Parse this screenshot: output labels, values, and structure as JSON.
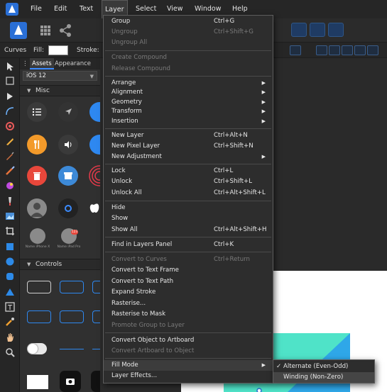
{
  "menubar": {
    "items": [
      "File",
      "Edit",
      "Text",
      "Layer",
      "Select",
      "View",
      "Window",
      "Help"
    ]
  },
  "contextbar": {
    "curves_label": "Curves",
    "fill_label": "Fill:",
    "stroke_label": "Stroke:"
  },
  "assets": {
    "tabs": [
      "Assets",
      "Appearance"
    ],
    "category": "iOS 12",
    "sections": [
      "Misc",
      "Controls"
    ],
    "asset_labels": [
      "Name iPhone X",
      "Name iPad Pro"
    ],
    "badge": "123"
  },
  "layer_menu": {
    "items": [
      {
        "label": "Group",
        "shortcut": "Ctrl+G",
        "disabled": false
      },
      {
        "label": "Ungroup",
        "shortcut": "Ctrl+Shift+G",
        "disabled": true
      },
      {
        "label": "Ungroup All",
        "shortcut": "",
        "disabled": true
      },
      {
        "label": "Create Compound",
        "shortcut": "",
        "disabled": true
      },
      {
        "label": "Release Compound",
        "shortcut": "",
        "disabled": true
      },
      {
        "label": "Arrange",
        "shortcut": "",
        "disabled": false,
        "submenu": true
      },
      {
        "label": "Alignment",
        "shortcut": "",
        "disabled": false,
        "submenu": true
      },
      {
        "label": "Geometry",
        "shortcut": "",
        "disabled": false,
        "submenu": true
      },
      {
        "label": "Transform",
        "shortcut": "",
        "disabled": false,
        "submenu": true
      },
      {
        "label": "Insertion",
        "shortcut": "",
        "disabled": false,
        "submenu": true
      },
      {
        "label": "New Layer",
        "shortcut": "Ctrl+Alt+N",
        "disabled": false
      },
      {
        "label": "New Pixel Layer",
        "shortcut": "Ctrl+Shift+N",
        "disabled": false
      },
      {
        "label": "New Adjustment",
        "shortcut": "",
        "disabled": false,
        "submenu": true
      },
      {
        "label": "Lock",
        "shortcut": "Ctrl+L",
        "disabled": false
      },
      {
        "label": "Unlock",
        "shortcut": "Ctrl+Shift+L",
        "disabled": false
      },
      {
        "label": "Unlock All",
        "shortcut": "Ctrl+Alt+Shift+L",
        "disabled": false
      },
      {
        "label": "Hide",
        "shortcut": "",
        "disabled": false
      },
      {
        "label": "Show",
        "shortcut": "",
        "disabled": false
      },
      {
        "label": "Show All",
        "shortcut": "Ctrl+Alt+Shift+H",
        "disabled": false
      },
      {
        "label": "Find in Layers Panel",
        "shortcut": "Ctrl+K",
        "disabled": false
      },
      {
        "label": "Convert to Curves",
        "shortcut": "Ctrl+Return",
        "disabled": true
      },
      {
        "label": "Convert to Text Frame",
        "shortcut": "",
        "disabled": false
      },
      {
        "label": "Convert to Text Path",
        "shortcut": "",
        "disabled": false
      },
      {
        "label": "Expand Stroke",
        "shortcut": "",
        "disabled": false
      },
      {
        "label": "Rasterise...",
        "shortcut": "",
        "disabled": false
      },
      {
        "label": "Rasterise to Mask",
        "shortcut": "",
        "disabled": false
      },
      {
        "label": "Promote Group to Layer",
        "shortcut": "",
        "disabled": true
      },
      {
        "label": "Convert Object to Artboard",
        "shortcut": "",
        "disabled": false
      },
      {
        "label": "Convert Artboard to Object",
        "shortcut": "",
        "disabled": true
      },
      {
        "label": "Fill Mode",
        "shortcut": "",
        "disabled": false,
        "submenu": true
      },
      {
        "label": "Layer Effects...",
        "shortcut": "",
        "disabled": false
      }
    ]
  },
  "fill_mode_submenu": {
    "items": [
      {
        "label": "Alternate (Even-Odd)",
        "checked": true
      },
      {
        "label": "Winding (Non-Zero)",
        "checked": false
      }
    ]
  },
  "colors": {
    "accent": "#2a6fd6",
    "menu_bg": "#2d2d2d",
    "teal": "#4fe3c8",
    "sky": "#2fa7e8"
  }
}
